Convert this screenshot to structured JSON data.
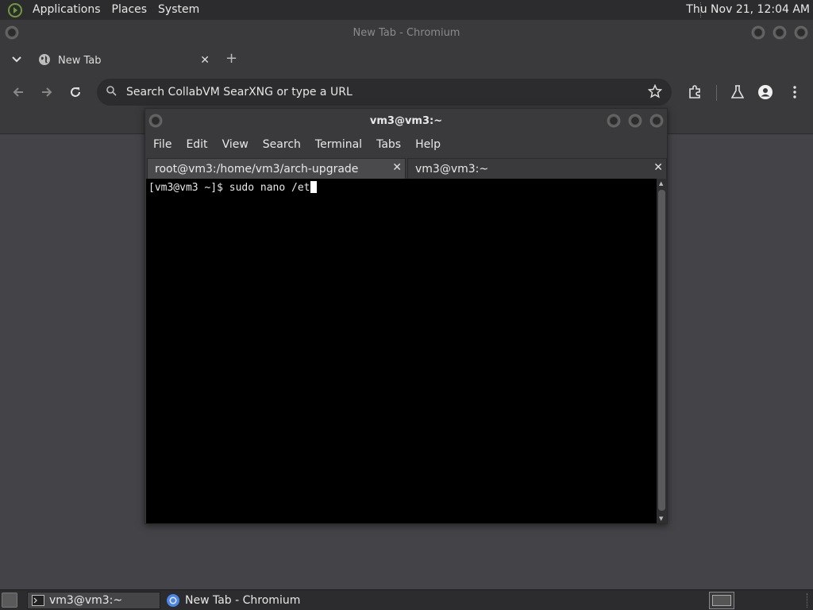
{
  "top_panel": {
    "menus": [
      "Applications",
      "Places",
      "System"
    ],
    "clock": "Thu Nov 21, 12:04 AM"
  },
  "chromium": {
    "window_title": "New Tab - Chromium",
    "tab_label": "New Tab",
    "omnibox_placeholder": "Search CollabVM SearXNG or type a URL"
  },
  "terminal": {
    "window_title": "vm3@vm3:~",
    "menus": [
      "File",
      "Edit",
      "View",
      "Search",
      "Terminal",
      "Tabs",
      "Help"
    ],
    "tabs": [
      {
        "label": "root@vm3:/home/vm3/arch-upgrade",
        "active": false
      },
      {
        "label": "vm3@vm3:~",
        "active": true
      }
    ],
    "prompt": "[vm3@vm3 ~]$ ",
    "input": "sudo nano /et"
  },
  "taskbar": {
    "items": [
      {
        "label": "vm3@vm3:~",
        "icon": "terminal-icon",
        "active": true
      },
      {
        "label": "New Tab - Chromium",
        "icon": "chromium-icon",
        "active": false
      }
    ]
  },
  "colors": {
    "panel": "#2c2c2e",
    "window": "#3a3a3c",
    "desktop": "#444448",
    "terminal_bg": "#000000"
  }
}
